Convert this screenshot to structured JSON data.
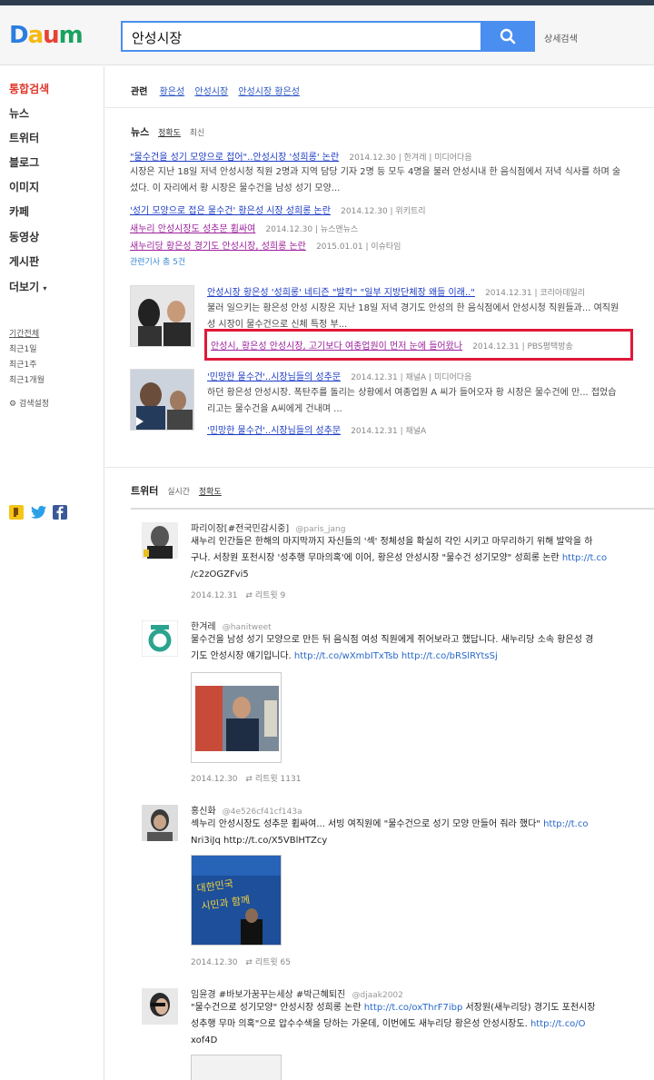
{
  "header": {
    "logo": "Daum",
    "search_value": "안성시장",
    "detail_search": "상세검색"
  },
  "sidebar": {
    "nav": [
      "통합검색",
      "뉴스",
      "트위터",
      "블로그",
      "이미지",
      "카페",
      "동영상",
      "게시판",
      "더보기"
    ],
    "periods": [
      "기간전체",
      "최근1일",
      "최근1주",
      "최근1개월"
    ],
    "settings": "검색설정"
  },
  "related": {
    "label": "관련",
    "links": [
      "황은성",
      "안성시장",
      "안성시장 황은성"
    ]
  },
  "news": {
    "title": "뉴스",
    "sort_accuracy": "정확도",
    "sort_latest": "최신",
    "items": [
      {
        "title": "\"물수건을 성기 모양으로 접어\"..안성시장 '성희롱' 논란",
        "meta": "2014.12.30 | 한겨레 | 미디어다음"
      },
      {
        "title": "'성기 모양으로 접은 물수건' 황은성 시장 성희롱 논란",
        "meta": "2014.12.30 | 위키트리"
      },
      {
        "title": "새누리 안성시장도 성추문 휩싸여",
        "meta": "2014.12.30 | 뉴스앤뉴스"
      },
      {
        "title": "새누리당 황은성 경기도 안성시장, 성희롱 논란",
        "meta": "2015.01.01 | 이슈타임"
      },
      {
        "title": "안성시장 황은성 '성희롱' 네티즌 \"발칵\" \"일부 지방단체장 왜들 이래..\"",
        "meta": "2014.12.31 | 코리아데일리"
      },
      {
        "title": "안성시, 황은성 안성시장, 고기보다 여종업원이 먼저 눈에 들어왔나",
        "meta": "2014.12.31 | PBS평택방송"
      },
      {
        "title": "'민망한 물수건'..시장님들의 성추문",
        "meta": "2014.12.31 | 채널A | 미디어다음"
      },
      {
        "title": "'민망한 물수건'..시장님들의 성추문",
        "meta": "2014.12.31 | 채널A"
      }
    ],
    "desc1_line1": "시장은 지난 18일 저녁 안성시청 직원 2명과 지역 담당 기자 2명 등 모두 4명을 불러 안성시내 한 음식점에서 저녁 식사를 하며 술",
    "desc1_line2": "섰다. 이 자리에서 황 시장은 물수건을 남성 성기 모양...",
    "desc5_line1": "불러 일으키는 황은성 안성 시장은 지난 18일 저녁 경기도 안성의 한 음식점에서 안성시청 직원들과... 여직원",
    "desc5_line2": "성 시장이 물수건으로 신체 특정 부...",
    "desc7_line1": "하던 황은성 안성시장. 폭탄주를 돌리는 상황에서 여종업원 A 씨가 들어오자 황 시장은 물수건에 만... 접었습",
    "desc7_line2": "리고는 물수건을 A씨에게 건내며 ...",
    "more": "관련기사 총 5건"
  },
  "twitter": {
    "title": "트위터",
    "sort_latest": "실시간",
    "sort_accuracy": "정확도",
    "tweets": [
      {
        "name": "파리이장[#전국민감시중]",
        "handle": "@paris_jang",
        "line1": "새누리 인간들은 한해의 마지막까지 자신들의 '섹' 정체성을 확실히 각인 시키고 마무리하기 위해 발악을 하",
        "line2a": "구나. 서창원 포천시장 '성추행 무마의혹'에 이어, 황은성 안성시장 \"물수건 성기모양\" 성희롱 논란 ",
        "line2b": "http://t.co",
        "line3": "/c2zOGZFvi5",
        "date": "2014.12.31",
        "retweet": "리트윗 9"
      },
      {
        "name": "한겨레",
        "handle": "@hanitweet",
        "line1": "물수건을 남성 성기 모양으로 만든 뒤 음식점 여성 직원에게 쥐어보라고 했답니다. 새누리당 소속 황은성 경",
        "line2a": "기도 안성시장 얘기입니다. ",
        "line2b": "http://t.co/wXmbITxTsb http://t.co/bRSlRYtsSj",
        "date": "2014.12.30",
        "retweet": "리트윗 1131"
      },
      {
        "name": "홍신화",
        "handle": "@4e526cf41cf143a",
        "line1a": "섹누리 안성시장도 성추문 휩싸여... 서빙 여직원에 \"물수건으로 성기 모양 만들어 줘라 했다\" ",
        "line1b": "http://t.co",
        "line2": "Nri3iJq http://t.co/X5VBlHTZcy",
        "date": "2014.12.30",
        "retweet": "리트윗 65"
      },
      {
        "name": "임윤경 #바보가꿈꾸는세상 #박근혜퇴진",
        "handle": "@djaak2002",
        "line1a": "\"물수건으로 성기모양\" 안성시장 성희롱 논란 ",
        "line1b": "http://t.co/oxThrF7ibp",
        "line1c": " 서장원(새누리당) 경기도 포천시장",
        "line2a": "성추행 무마 의혹\"으로 압수수색을 당하는 가운데, 이번에도 새누리당 황은성 안성시장도. ",
        "line2b": "http://t.co/O",
        "line3": "xof4D"
      }
    ]
  },
  "colors": {
    "accent_blue": "#4a8ef0",
    "active_red": "#e0362a",
    "highlight_red": "#e0183a",
    "link_blue": "#1c3bc5"
  }
}
